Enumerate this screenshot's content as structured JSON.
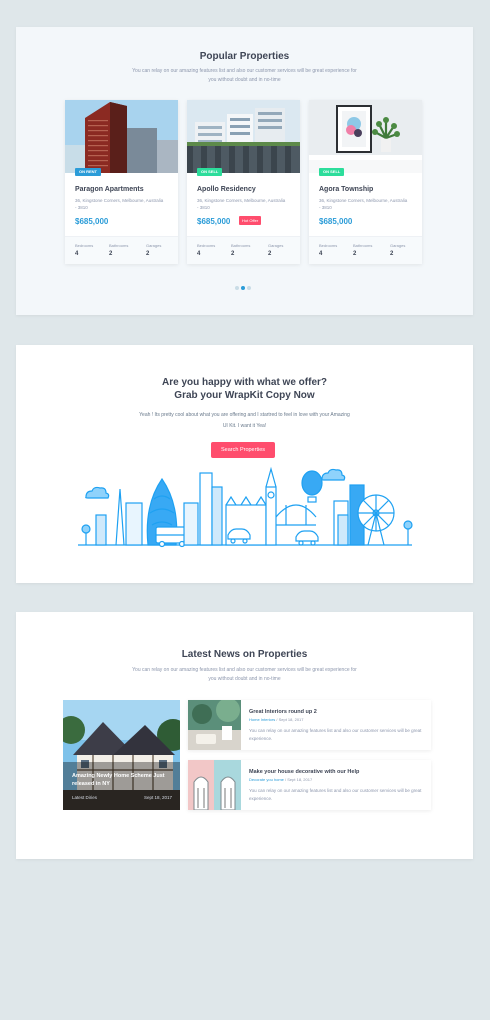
{
  "properties": {
    "title": "Popular Properties",
    "subtitle": "You can relay on our amazing features list and also our customer services will be great experience for you without doubt and in no-time",
    "cards": [
      {
        "badge": "ON RENT",
        "name": "Paragon Apartments",
        "address": "36, Kingstone Corners, Melbourne, Australia - 3810",
        "price": "$685,000",
        "hot": "",
        "stats": [
          {
            "label": "Bedrooms",
            "value": "4"
          },
          {
            "label": "Bathrooms",
            "value": "2"
          },
          {
            "label": "Garages",
            "value": "2"
          }
        ]
      },
      {
        "badge": "ON SELL",
        "name": "Apollo Residency",
        "address": "36, Kingstone Corners, Melbourne, Australia - 3810",
        "price": "$685,000",
        "hot": "Hot Offer",
        "stats": [
          {
            "label": "Bedrooms",
            "value": "4"
          },
          {
            "label": "Bathrooms",
            "value": "2"
          },
          {
            "label": "Garages",
            "value": "2"
          }
        ]
      },
      {
        "badge": "ON SELL",
        "name": "Agora Township",
        "address": "36, Kingstone Corners, Melbourne, Australia - 3810",
        "price": "$685,000",
        "hot": "",
        "stats": [
          {
            "label": "Bedrooms",
            "value": "4"
          },
          {
            "label": "Bathrooms",
            "value": "2"
          },
          {
            "label": "Garages",
            "value": "2"
          }
        ]
      }
    ],
    "badge_colors": {
      "rent": "#2b9cd8",
      "sell": "#2cdd9b"
    },
    "active_page": 2,
    "page_count": 3
  },
  "offer": {
    "title_line1": "Are you happy with what we offer?",
    "title_line2": "Grab your WrapKit Copy Now",
    "text": "Yeah ! Its pretty cool about what you are offering and I startred to feel in love with your Amazing UI Kit. I want it Yea!",
    "button": "Search Properties",
    "accent": "#ff4d6d"
  },
  "news": {
    "title": "Latest News on Properties",
    "subtitle": "You can relay on our amazing features list and also our customer services will be great experience for you without doubt and in no-time",
    "featured": {
      "title": "Amazing Newly Home Scheme Just released in NY",
      "category": "Latest Diries",
      "date": "Sept 18, 2017"
    },
    "items": [
      {
        "title": "Great Interiors round up 2",
        "category": "Home Interiors",
        "date": "Sept 18, 2017",
        "text": "You can relay on our amazing features list and also our customer services will be great experience."
      },
      {
        "title": "Make your house decorative with our Help",
        "category": "Decorate you home",
        "date": "Sept 18, 2017",
        "text": "You can relay on our amazing features list and also our customer services will be great experience."
      }
    ]
  }
}
